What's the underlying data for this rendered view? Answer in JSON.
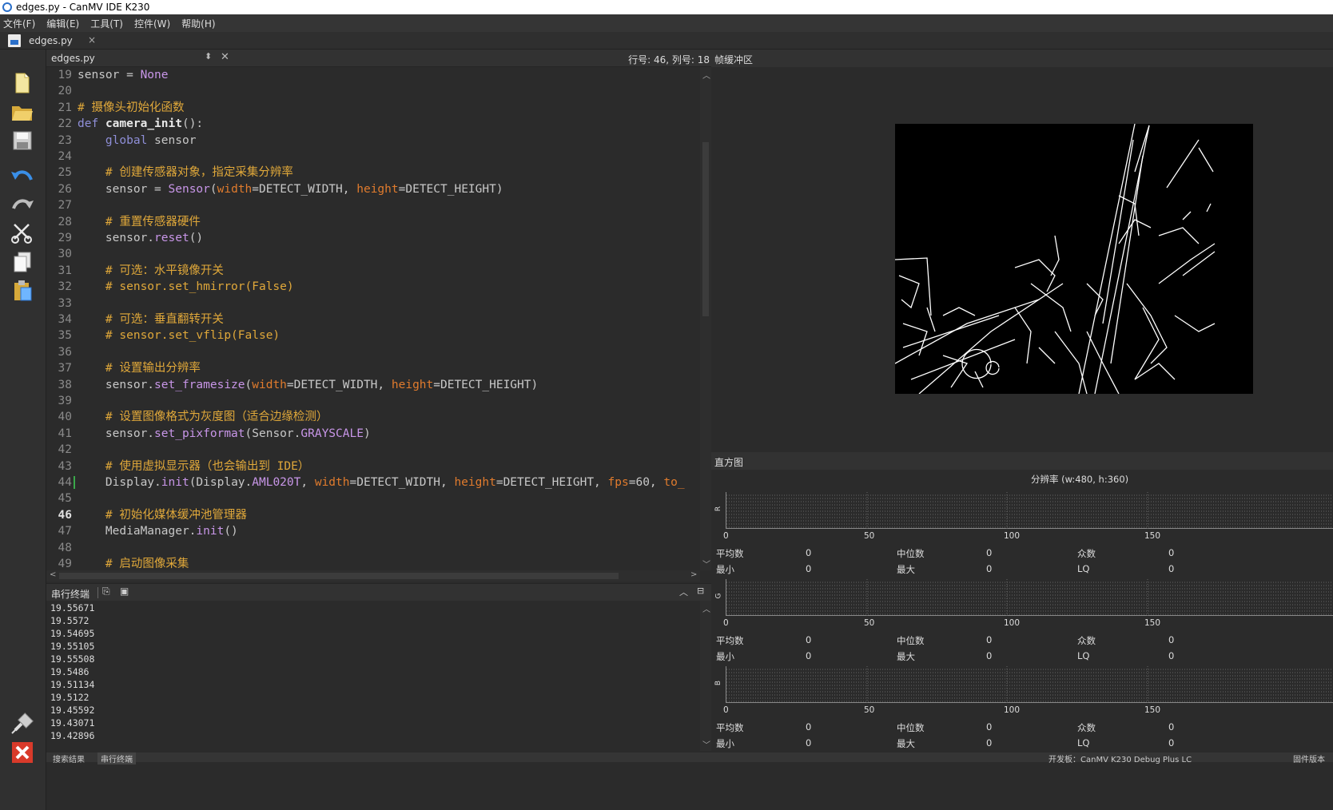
{
  "window": {
    "title": "edges.py - CanMV IDE K230"
  },
  "menu": [
    "文件(F)",
    "编辑(E)",
    "工具(T)",
    "控件(W)",
    "帮助(H)"
  ],
  "doc_tab": {
    "label": "edges.py",
    "close": "×"
  },
  "editor": {
    "file": "edges.py",
    "position": "行号: 46, 列号: 18",
    "current_line": 46
  },
  "code_lines": [
    {
      "n": "19",
      "html": "sensor = <span class='m'>None</span>"
    },
    {
      "n": "20",
      "html": ""
    },
    {
      "n": "21",
      "html": "<span class='c'># 摄像头初始化函数</span>"
    },
    {
      "n": "22",
      "html": "<span class='k'>def</span> <span class='f'>camera_init</span>():"
    },
    {
      "n": "23",
      "html": "    <span class='k'>global</span> sensor"
    },
    {
      "n": "24",
      "html": ""
    },
    {
      "n": "25",
      "html": "    <span class='c'># 创建传感器对象，指定采集分辨率</span>"
    },
    {
      "n": "26",
      "html": "    sensor = <span class='n'>Sensor</span>(<span class='p'>width</span>=DETECT_WIDTH, <span class='p'>height</span>=DETECT_HEIGHT)"
    },
    {
      "n": "27",
      "html": ""
    },
    {
      "n": "28",
      "html": "    <span class='c'># 重置传感器硬件</span>"
    },
    {
      "n": "29",
      "html": "    sensor.<span class='n'>reset</span>()"
    },
    {
      "n": "30",
      "html": ""
    },
    {
      "n": "31",
      "html": "    <span class='c'># 可选：水平镜像开关</span>"
    },
    {
      "n": "32",
      "html": "    <span class='c'># sensor.set_hmirror(False)</span>"
    },
    {
      "n": "33",
      "html": ""
    },
    {
      "n": "34",
      "html": "    <span class='c'># 可选：垂直翻转开关</span>"
    },
    {
      "n": "35",
      "html": "    <span class='c'># sensor.set_vflip(False)</span>"
    },
    {
      "n": "36",
      "html": ""
    },
    {
      "n": "37",
      "html": "    <span class='c'># 设置输出分辨率</span>"
    },
    {
      "n": "38",
      "html": "    sensor.<span class='n'>set_framesize</span>(<span class='p'>width</span>=DETECT_WIDTH, <span class='p'>height</span>=DETECT_HEIGHT)"
    },
    {
      "n": "39",
      "html": ""
    },
    {
      "n": "40",
      "html": "    <span class='c'># 设置图像格式为灰度图（适合边缘检测）</span>"
    },
    {
      "n": "41",
      "html": "    sensor.<span class='n'>set_pixformat</span>(Sensor.<span class='m'>GRAYSCALE</span>)"
    },
    {
      "n": "42",
      "html": ""
    },
    {
      "n": "43",
      "html": "    <span class='c'># 使用虚拟显示器（也会输出到 IDE）</span>"
    },
    {
      "n": "44",
      "html": "    Display.<span class='n'>init</span>(Display.<span class='m'>AML020T</span>, <span class='p'>width</span>=DETECT_WIDTH, <span class='p'>height</span>=DETECT_HEIGHT, <span class='p'>fps</span>=60, <span class='p'>to_</span>"
    },
    {
      "n": "45",
      "html": ""
    },
    {
      "n": "46",
      "html": "    <span class='c'># 初始化媒体缓冲池管理器</span>"
    },
    {
      "n": "47",
      "html": "    MediaManager.<span class='n'>init</span>()"
    },
    {
      "n": "48",
      "html": ""
    },
    {
      "n": "49",
      "html": "    <span class='c'># 启动图像采集</span>"
    }
  ],
  "terminal": {
    "title": "串行终端",
    "lines": [
      "19.55671",
      "19.5572",
      "19.54695",
      "19.55105",
      "19.55508",
      "19.5486",
      "19.51134",
      "19.5122",
      "19.45592",
      "19.43071",
      "19.42896"
    ]
  },
  "framebuffer": {
    "title": "帧缓冲区"
  },
  "histogram": {
    "title": "直方图",
    "resolution": "分辨率 (w:480, h:360)",
    "channels": [
      {
        "letter": "R",
        "stats": [
          "平均数",
          "0",
          "中位数",
          "0",
          "众数",
          "0",
          "最小",
          "0",
          "最大",
          "0",
          "LQ",
          "0"
        ]
      },
      {
        "letter": "G",
        "stats": [
          "平均数",
          "0",
          "中位数",
          "0",
          "众数",
          "0",
          "最小",
          "0",
          "最大",
          "0",
          "LQ",
          "0"
        ]
      },
      {
        "letter": "B",
        "stats": [
          "平均数",
          "0",
          "中位数",
          "0",
          "众数",
          "0",
          "最小",
          "0",
          "最大",
          "0",
          "LQ",
          "0"
        ]
      }
    ],
    "ticks": [
      "0",
      "50",
      "100",
      "150"
    ]
  },
  "bottom": {
    "left": "搜索结果",
    "tab": "串行终端",
    "right1": "开发板：CanMV K230 Debug Plus LC",
    "right2": "固件版本"
  }
}
